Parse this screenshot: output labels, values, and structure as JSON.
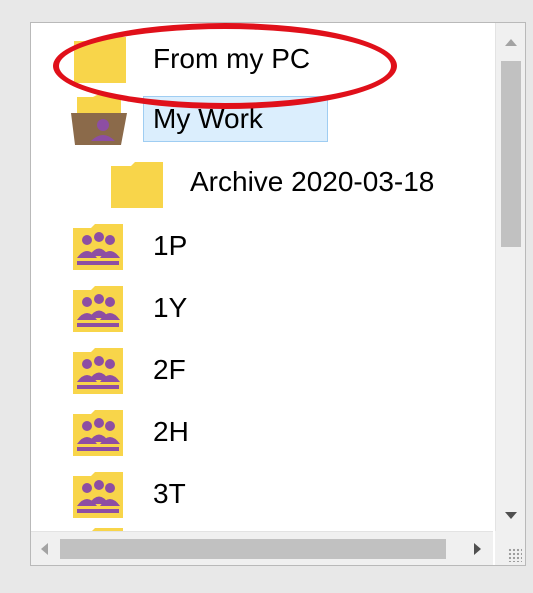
{
  "tree": {
    "items": [
      {
        "label": "From my PC",
        "icon": "folder-icon",
        "selected": false
      },
      {
        "label": "My Work",
        "icon": "open-folder-user-icon",
        "selected": true
      },
      {
        "label": "Archive 2020-03-18",
        "icon": "folder-icon",
        "selected": false
      },
      {
        "label": "1P",
        "icon": "group-folder-icon",
        "selected": false
      },
      {
        "label": "1Y",
        "icon": "group-folder-icon",
        "selected": false
      },
      {
        "label": "2F",
        "icon": "group-folder-icon",
        "selected": false
      },
      {
        "label": "2H",
        "icon": "group-folder-icon",
        "selected": false
      },
      {
        "label": "3T",
        "icon": "group-folder-icon",
        "selected": false
      }
    ]
  },
  "colors": {
    "folder": "#f8d54a",
    "folder_dark": "#e7b928",
    "group_people": "#8d4ea3",
    "selection_bg": "#dbeefd",
    "annotation": "#e0101a"
  }
}
